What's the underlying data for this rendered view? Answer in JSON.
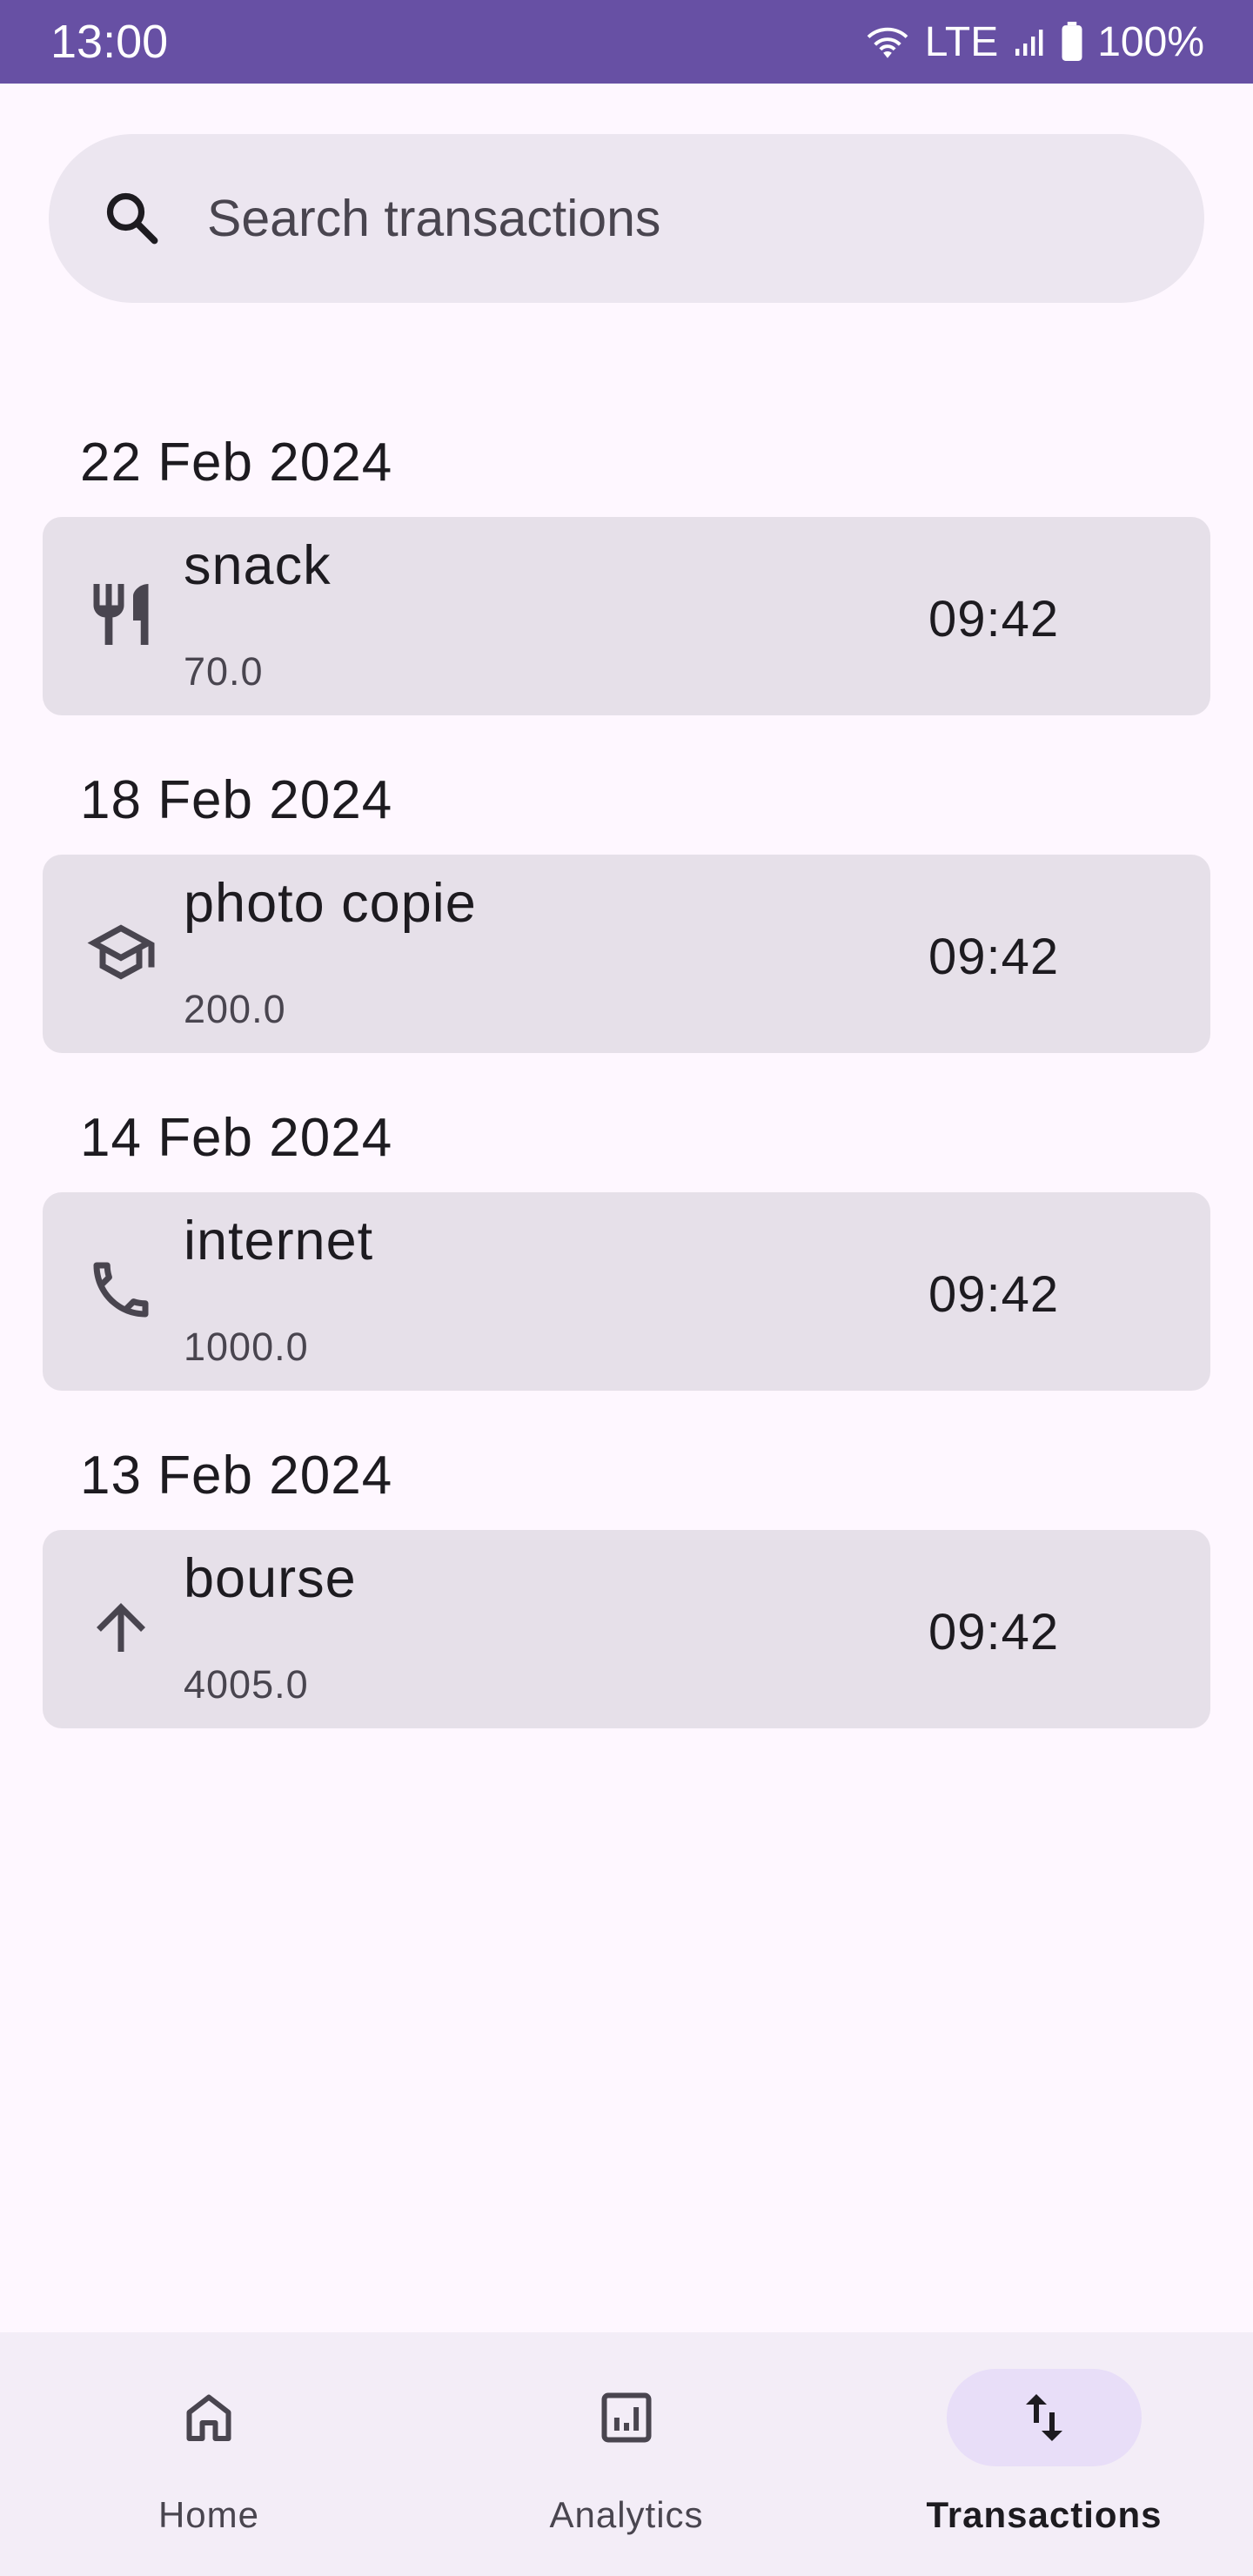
{
  "status_bar": {
    "time": "13:00",
    "network": "LTE",
    "battery": "100%",
    "icons": [
      "wifi-icon",
      "cell-signal-icon",
      "battery-icon"
    ]
  },
  "search": {
    "placeholder": "Search transactions",
    "icon": "search-icon"
  },
  "transaction_groups": [
    {
      "date": "22 Feb 2024",
      "items": [
        {
          "title": "snack",
          "amount": "70.0",
          "time": "09:42",
          "icon": "restaurant-icon"
        }
      ]
    },
    {
      "date": "18 Feb 2024",
      "items": [
        {
          "title": "photo copie",
          "amount": "200.0",
          "time": "09:42",
          "icon": "school-icon"
        }
      ]
    },
    {
      "date": "14 Feb 2024",
      "items": [
        {
          "title": "internet",
          "amount": "1000.0",
          "time": "09:42",
          "icon": "phone-icon"
        }
      ]
    },
    {
      "date": "13 Feb 2024",
      "items": [
        {
          "title": "bourse",
          "amount": "4005.0",
          "time": "09:42",
          "icon": "arrow-up-icon"
        }
      ]
    }
  ],
  "bottom_nav": {
    "items": [
      {
        "label": "Home",
        "icon": "home-icon",
        "active": false
      },
      {
        "label": "Analytics",
        "icon": "analytics-icon",
        "active": false
      },
      {
        "label": "Transactions",
        "icon": "swap-vert-icon",
        "active": true
      }
    ]
  },
  "colors": {
    "primary": "#6750A4",
    "background": "#FEF7FF",
    "card": "#E6E0E9",
    "search_bar": "#ECE6F0",
    "nav_bar": "#F3EDF7",
    "active_indicator": "#E8DEF8"
  }
}
